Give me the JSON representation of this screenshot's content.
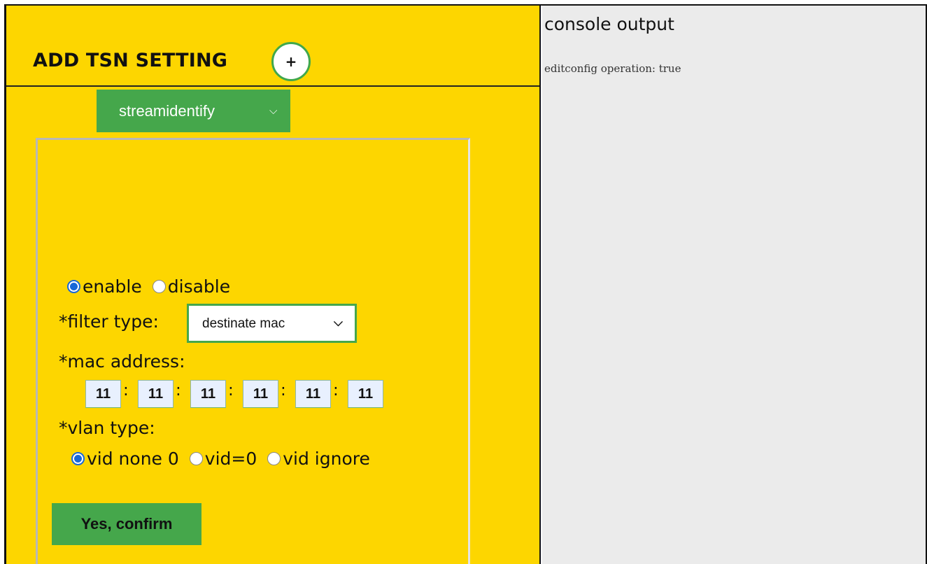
{
  "header": {
    "title": "ADD TSN SETTING",
    "add_button_symbol": "+"
  },
  "setting_type": {
    "selected": "streamidentify",
    "icon": "chevron-down-icon"
  },
  "form": {
    "status": {
      "options": [
        "enable",
        "disable"
      ],
      "selected": "enable"
    },
    "filter_type": {
      "label": "*filter type:",
      "selected": "destinate mac"
    },
    "mac_address": {
      "label": "*mac address:",
      "octets": [
        "11",
        "11",
        "11",
        "11",
        "11",
        "11"
      ],
      "separator": ":"
    },
    "vlan_type": {
      "label": "*vlan type:",
      "options": [
        "vid none 0",
        "vid=0",
        "vid ignore"
      ],
      "selected": "vid none 0"
    },
    "confirm_label": "Yes, confirm"
  },
  "console": {
    "title": "console output",
    "lines": [
      "editconfig operation: true"
    ]
  },
  "colors": {
    "panel_yellow": "#fdd600",
    "accent_green": "#45a74b",
    "radio_blue": "#1868d8",
    "console_bg": "#ebebeb"
  }
}
